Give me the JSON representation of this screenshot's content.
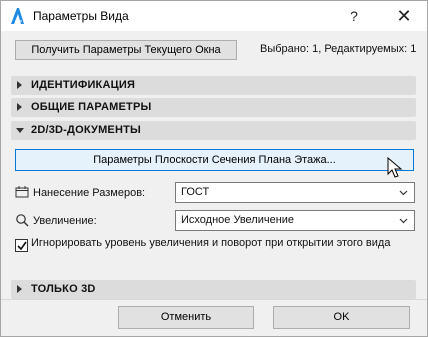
{
  "window": {
    "title": "Параметры Вида",
    "help_label": "?",
    "close_label": "✕"
  },
  "toolbar": {
    "get_params_label": "Получить Параметры Текущего Окна",
    "selection_info": "Выбрано: 1, Редактируемых: 1"
  },
  "sections": {
    "identification": "ИДЕНТИФИКАЦИЯ",
    "general": "ОБЩИЕ ПАРАМЕТРЫ",
    "documents": "2D/3D-ДОКУМЕНТЫ",
    "only3d": "ТОЛЬКО 3D"
  },
  "documents_panel": {
    "plan_cut_button": "Параметры Плоскости Сечения Плана Этажа...",
    "dimensioning_label": "Нанесение Размеров:",
    "dimensioning_value": "ГОСТ",
    "zoom_label": "Увеличение:",
    "zoom_value": "Исходное Увеличение",
    "ignore_zoom_label": "Игнорировать уровень увеличения и поворот при открытии этого вида",
    "ignore_zoom_checked": true
  },
  "footer": {
    "cancel_label": "Отменить",
    "ok_label": "OK"
  },
  "icons": {
    "app": "archicad-icon",
    "dimension": "dimension-icon",
    "zoom": "magnifier-icon"
  },
  "colors": {
    "dialog_bg": "#f0f0f0",
    "section_bg": "#dcdcdc",
    "accent_border": "#0078d7",
    "hover_bg": "#e5f1fb"
  }
}
